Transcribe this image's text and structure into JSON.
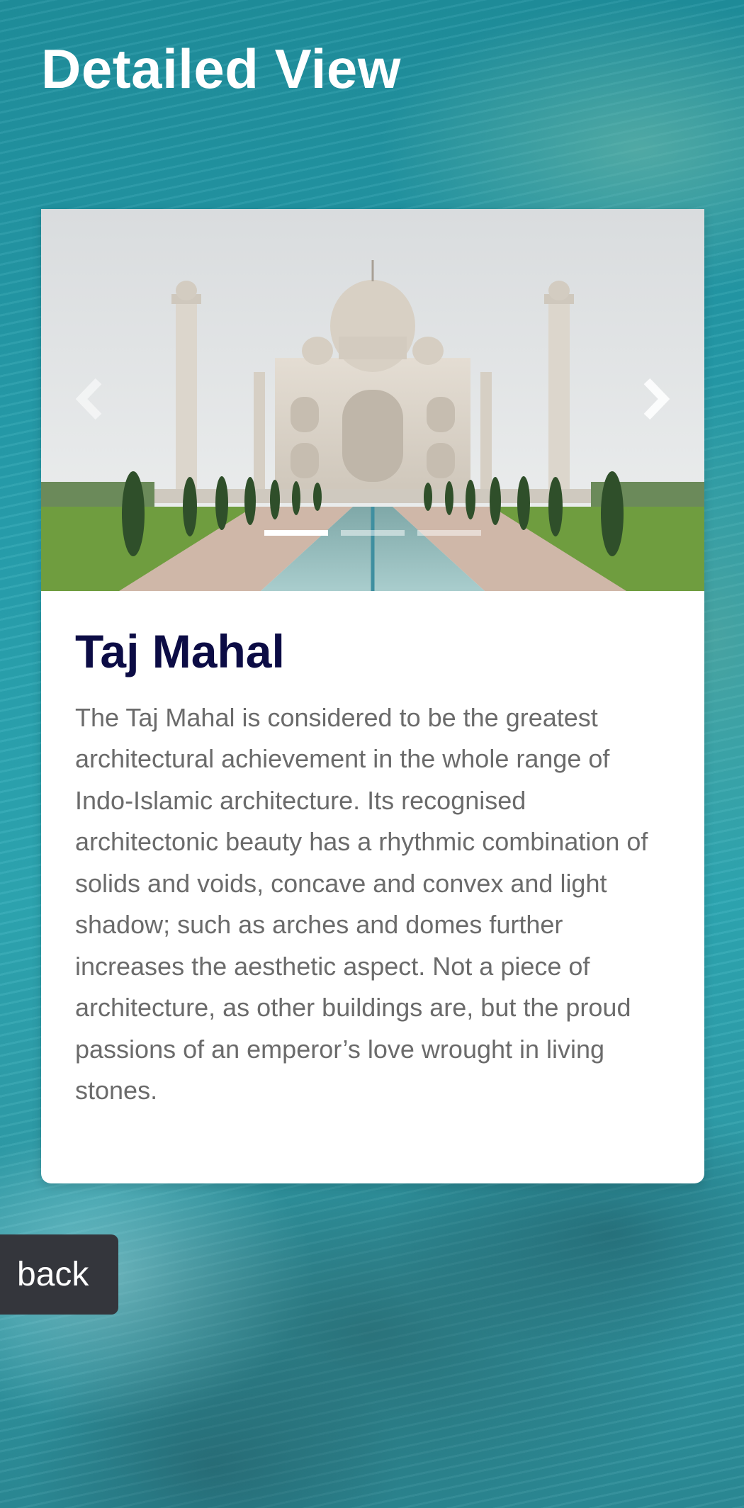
{
  "page": {
    "title": "Detailed View"
  },
  "carousel": {
    "slide_count": 3,
    "active_index": 0,
    "image_subject": "Taj Mahal photo",
    "prev_icon": "chevron-left-icon",
    "next_icon": "chevron-right-icon"
  },
  "place": {
    "name": "Taj Mahal",
    "description": "The Taj Mahal is considered to be the greatest architectural achievement in the whole range of Indo-Islamic architecture. Its recognised architectonic beauty has a rhythmic combination of solids and voids, concave and convex and light shadow; such as arches and domes further increases the aesthetic aspect. Not a piece of architecture, as other buildings are, but the proud passions of an emperor’s love wrought in living stones."
  },
  "actions": {
    "back_label": "back"
  },
  "colors": {
    "title_text": "#ffffff",
    "card_heading": "#0c0c45",
    "body_text": "#6b6b6b",
    "back_button_bg": "#34363c",
    "background_teal": "#27a0ae"
  }
}
